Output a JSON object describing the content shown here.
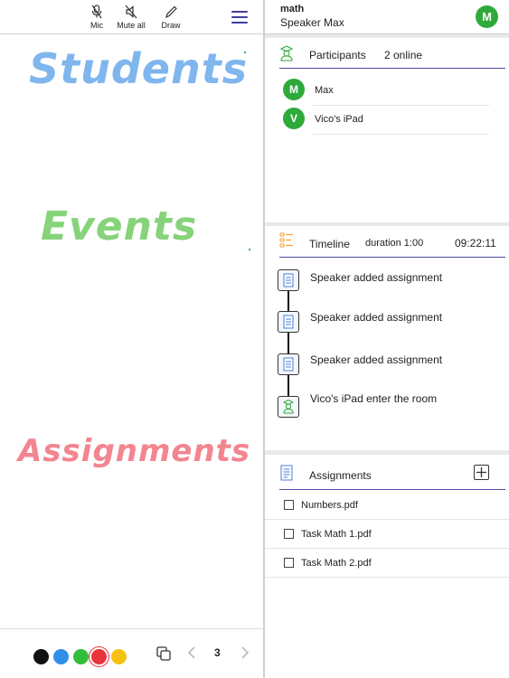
{
  "toolbar": {
    "mic_label": "Mic",
    "mute_all_label": "Mute all",
    "draw_label": "Draw"
  },
  "board": {
    "ink_words": [
      {
        "text": "Students",
        "color": "#7fb6ee"
      },
      {
        "text": "Events",
        "color": "#86d37a"
      },
      {
        "text": "Assignments",
        "color": "#f2858f"
      }
    ]
  },
  "palette": {
    "colors": [
      "#111111",
      "#2f8fe8",
      "#2fbf3a",
      "#e8343b",
      "#f7c20f"
    ],
    "selected_index": 3
  },
  "pager": {
    "page": "3"
  },
  "header": {
    "room_name": "math",
    "speaker": "Speaker Max",
    "avatar_letter": "M"
  },
  "participants": {
    "title": "Participants",
    "online": "2 online",
    "list": [
      {
        "letter": "M",
        "name": "Max"
      },
      {
        "letter": "V",
        "name": "Vico's iPad"
      }
    ]
  },
  "timeline": {
    "title": "Timeline",
    "duration": "duration 1:00",
    "clock": "09:22:11",
    "events": [
      {
        "text": "Speaker added assignment",
        "icon": "document-icon"
      },
      {
        "text": "Speaker added assignment",
        "icon": "document-icon"
      },
      {
        "text": "Speaker added assignment",
        "icon": "document-icon"
      },
      {
        "text": "Vico's iPad enter the room",
        "icon": "user-icon"
      }
    ]
  },
  "assignments": {
    "title": "Assignments",
    "files": [
      "Numbers.pdf",
      "Task Math 1.pdf",
      "Task Math 2.pdf"
    ]
  },
  "colors": {
    "accent": "#4b4ba6",
    "avatar_green": "#2eaa3b",
    "timeline_orange": "#f0a030"
  }
}
